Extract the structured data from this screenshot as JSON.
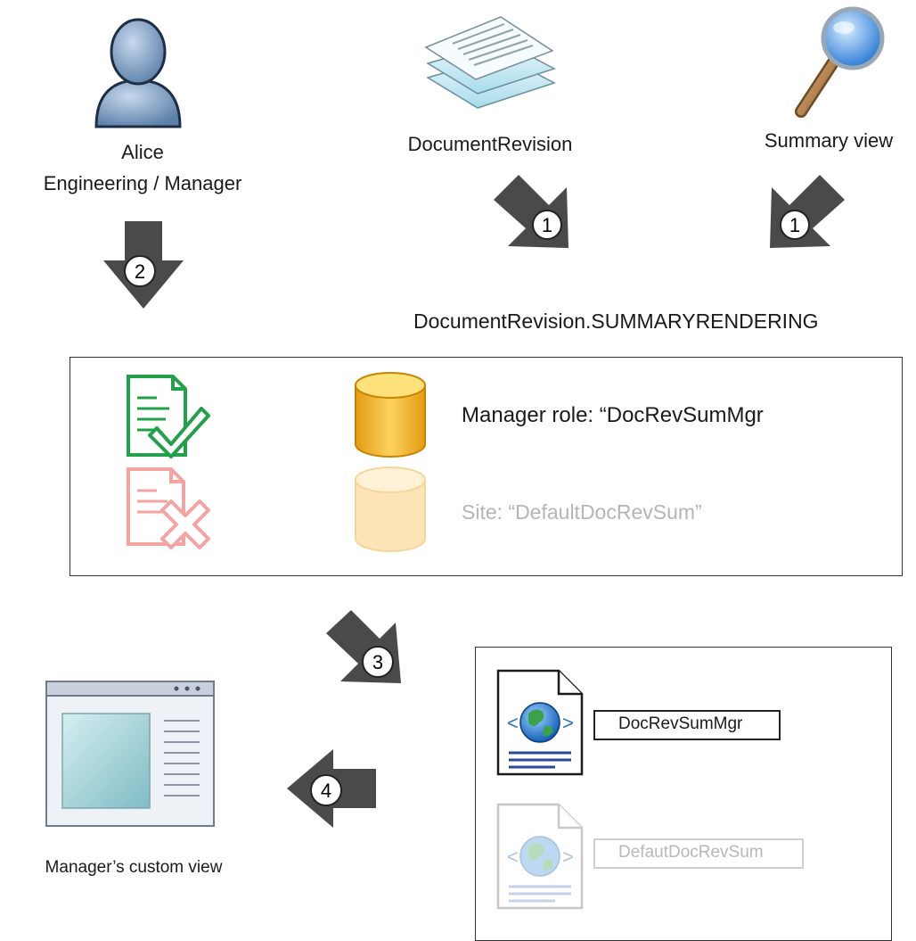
{
  "actors": {
    "user_name": "Alice",
    "user_role": "Engineering / Manager",
    "document_type": "DocumentRevision",
    "view_type": "Summary view"
  },
  "rendering_key": "DocumentRevision.SUMMARYRENDERING",
  "resolution": {
    "manager_entry": "Manager role: “DocRevSumMgr",
    "site_entry": "Site: “DefaultDocRevSum”"
  },
  "templates": {
    "manager_template": "DocRevSumMgr",
    "default_template": "DefautDocRevSum"
  },
  "result_label": "Manager’s custom view",
  "steps": [
    "1",
    "1",
    "2",
    "3",
    "4"
  ],
  "colors": {
    "arrow": "#4a4a4a",
    "accepted": "#23a04a",
    "rejected": "#f4a3a3",
    "db_active": "#f3b62a",
    "db_inactive": "#fde4b6"
  },
  "icons": [
    "user-icon",
    "document-stack-icon",
    "magnifier-icon",
    "document-check-icon",
    "document-x-icon",
    "database-icon",
    "web-document-icon",
    "browser-window-icon"
  ]
}
